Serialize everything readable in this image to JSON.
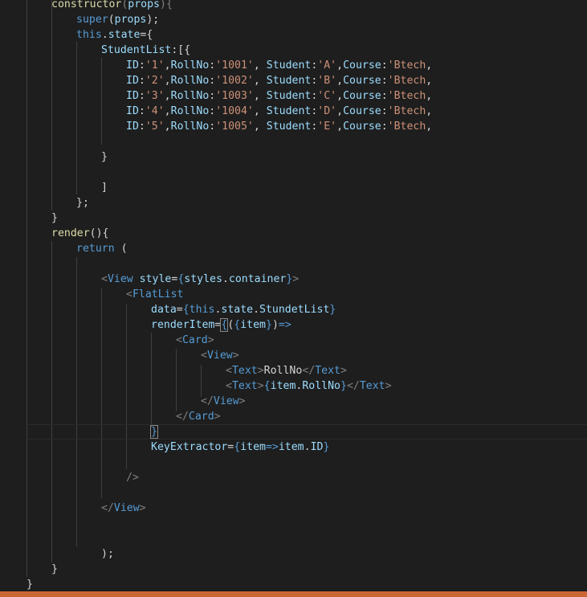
{
  "editor": {
    "tokens": {
      "constructor": "constructor",
      "props": "props",
      "super": "super",
      "this": "this",
      "state": "state",
      "StudentList": "StudentList",
      "ID": "ID",
      "RollNo": "RollNo",
      "Student": "Student",
      "Course": "Course",
      "id1": "'1'",
      "roll1": "'1001'",
      "stu1": "'A'",
      "id2": "'2'",
      "roll2": "'1002'",
      "stu2": "'B'",
      "id3": "'3'",
      "roll3": "'1003'",
      "stu3": "'C'",
      "id4": "'4'",
      "roll4": "'1004'",
      "stu4": "'D'",
      "id5": "'5'",
      "roll5": "'1005'",
      "stu5": "'E'",
      "course": "'Btech",
      "render": "render",
      "return": "return",
      "View": "View",
      "style": "style",
      "styles": "styles",
      "container": "container",
      "FlatList": "FlatList",
      "data": "data",
      "StundetList": "StundetList",
      "renderItem": "renderItem",
      "item": "item",
      "Card": "Card",
      "Text": "Text",
      "RollNoText": "RollNo",
      "KeyExtractor": "KeyExtractor",
      "arrow": "=>"
    }
  },
  "status_bar": {
    "color": "#cc6633"
  },
  "theme": {
    "background": "#1e1e1e",
    "keyword": "#569cd6",
    "variable": "#9cdcfe",
    "function": "#dcdcaa",
    "string": "#ce9178",
    "punctuation": "#808080",
    "text": "#d4d4d4"
  }
}
